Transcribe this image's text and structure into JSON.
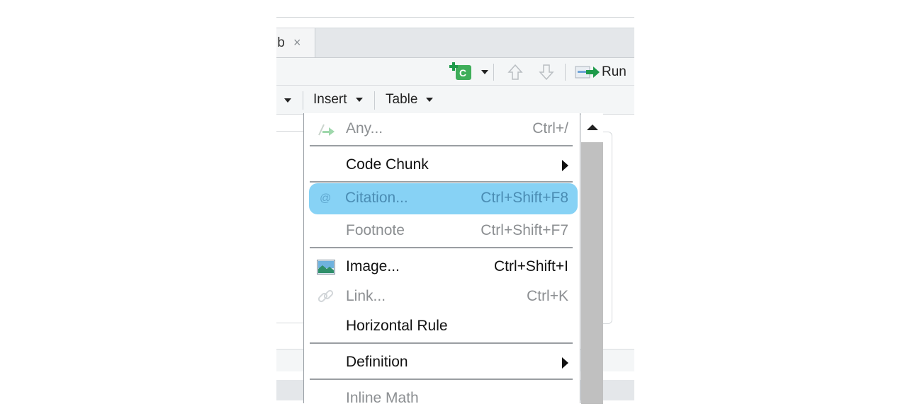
{
  "tab": {
    "name": "ib",
    "close": "×"
  },
  "toolbar": {
    "run_label": "Run",
    "insert_chunk_icon": "add-chunk-c-icon",
    "chunk_letter": "C"
  },
  "format_bar": {
    "insert_label": "Insert",
    "table_label": "Table"
  },
  "menu": {
    "items": [
      {
        "label": "Any...",
        "shortcut": "Ctrl+/",
        "disabled": true,
        "icon": "insert-arrow-icon"
      },
      {
        "label": "Code Chunk",
        "submenu": true
      },
      {
        "label": "Citation...",
        "shortcut": "Ctrl+Shift+F8",
        "highlighted": true,
        "icon": "at-sign-icon"
      },
      {
        "label": "Footnote",
        "shortcut": "Ctrl+Shift+F7",
        "disabled": true
      },
      {
        "label": "Image...",
        "shortcut": "Ctrl+Shift+I",
        "icon": "image-icon"
      },
      {
        "label": "Link...",
        "shortcut": "Ctrl+K",
        "disabled": true,
        "icon": "link-icon"
      },
      {
        "label": "Horizontal Rule"
      },
      {
        "label": "Definition",
        "submenu": true
      },
      {
        "label": "Inline Math",
        "disabled": true
      }
    ]
  },
  "colors": {
    "highlight": "#87d2f5",
    "chunk_green": "#3fae5a",
    "run_arrow": "#1e9a4a"
  }
}
